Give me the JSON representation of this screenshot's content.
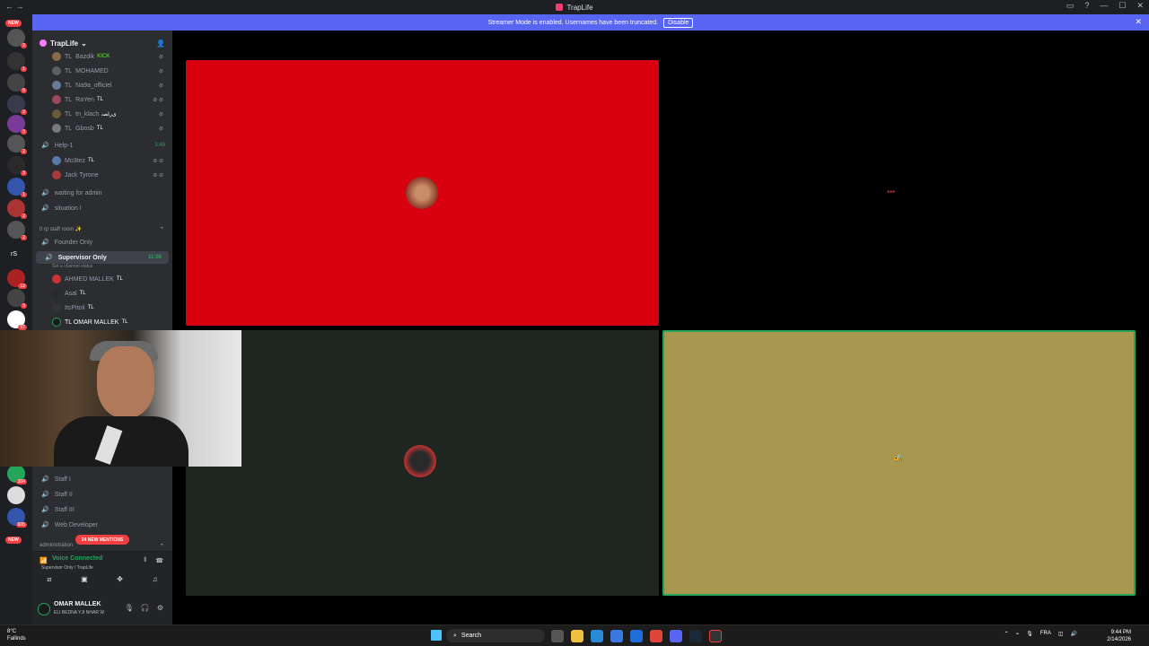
{
  "app": {
    "title": "TrapLife"
  },
  "banner": {
    "message": "Streamer Mode is enabled. Usernames have been truncated.",
    "button": "Disable"
  },
  "servers": {
    "new_top": "NEW",
    "new_bottom": "NEW",
    "rs_label": "rS",
    "pings": [
      "2",
      "1",
      "6",
      "2",
      "3",
      "2",
      "3",
      "1",
      "2",
      "2",
      "12",
      "3",
      "67"
    ],
    "bottom_pings": [
      "304",
      "605"
    ]
  },
  "guild": {
    "name": "TrapLife"
  },
  "members_top": [
    {
      "tag": "TL",
      "name": "Bazdik",
      "badge": "KICK"
    },
    {
      "tag": "TL",
      "name": "MOHAMED",
      "badge": ""
    },
    {
      "tag": "TL",
      "name": "Na9a_officiel",
      "badge": ""
    },
    {
      "tag": "TL",
      "name": "RaYen",
      "badge": "TL"
    },
    {
      "tag": "TL",
      "name": "tn_klach",
      "badge": "ﻯﺭﺎﺼﻧ"
    },
    {
      "tag": "TL",
      "name": "Gbosb",
      "badge": "TL"
    }
  ],
  "help_channel": {
    "name": "Help-1",
    "time": "3:46"
  },
  "help_members": [
    {
      "name": "Mo3tez",
      "badge": "TL"
    },
    {
      "name": "Jack Tyrone",
      "badge": ""
    }
  ],
  "channels_mid": [
    {
      "name": "waiting for admin"
    },
    {
      "name": "situation I"
    }
  ],
  "category_staff": {
    "name": "tl rp staff room ✨"
  },
  "founder_channel": {
    "name": "Founder Only"
  },
  "supervisor_channel": {
    "name": "Supervisor Only",
    "time": "11:08",
    "status": "Set a channel status"
  },
  "supervisor_members": [
    {
      "name": "AHMED MALLEK",
      "badge": "TL"
    },
    {
      "name": "Asal",
      "badge": "TL"
    },
    {
      "name": "ItsPitoli",
      "badge": "TL"
    },
    {
      "name": "TL OMAR MALLEK",
      "badge": "TL"
    }
  ],
  "staff_channels": [
    {
      "name": "Staff I"
    },
    {
      "name": "Staff II"
    },
    {
      "name": "Staff III"
    },
    {
      "name": "Web Developer"
    }
  ],
  "mentions": "24 NEW MENTIONS",
  "category_admin": {
    "name": "administration"
  },
  "voice": {
    "title": "Voice Connected",
    "sub": "Supervisor Only / TrapLife"
  },
  "user": {
    "name": "OMAR MALLEK",
    "status": "ELI BEDNA YJI NHAR W"
  },
  "taskbar": {
    "weather_temp": "8°C",
    "weather_desc": "Fallinds",
    "search": "Search",
    "lang": "FRA",
    "time": "9:44 PM",
    "date": "2/14/2026"
  },
  "tiles": [
    {
      "bg": "#d9000f"
    },
    {
      "bg": "#000000"
    },
    {
      "bg": "#1f2621"
    },
    {
      "bg": "#a8974f"
    }
  ],
  "colors": {
    "blurple": "#5865f2",
    "green": "#23a55a",
    "red": "#f23f43",
    "sidebar": "#2b2d31"
  }
}
